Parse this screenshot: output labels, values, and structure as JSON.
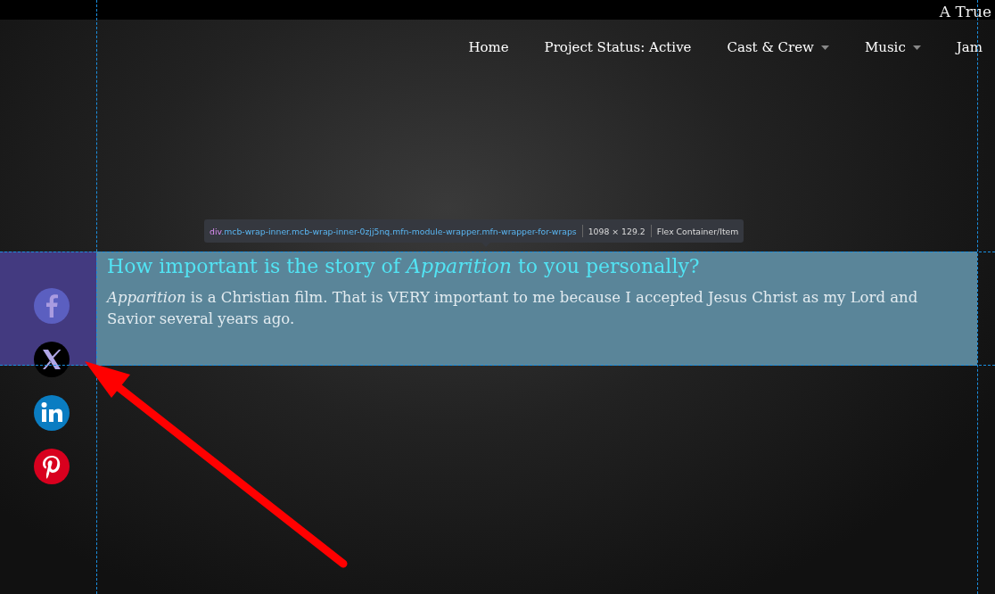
{
  "site_title": "A True",
  "nav": [
    {
      "label": "Home",
      "has_dropdown": false
    },
    {
      "label": "Project Status: Active",
      "has_dropdown": false
    },
    {
      "label": "Cast & Crew",
      "has_dropdown": true
    },
    {
      "label": "Music",
      "has_dropdown": true
    },
    {
      "label": "Jam",
      "has_dropdown": false
    }
  ],
  "inspector_tooltip": {
    "tag": "div",
    "classes": ".mcb-wrap-inner.mcb-wrap-inner-0zjj5nq.mfn-module-wrapper.mfn-wrapper-for-wraps",
    "size": "1098 × 129.2",
    "role": "Flex Container/Item"
  },
  "section": {
    "heading": "How important is the story of *Apparition* to you personally?",
    "body": "*Apparition* is a Christian film. That is VERY important to me because I accepted Jesus Christ as my Lord and Savior several years ago."
  },
  "social": [
    {
      "kind": "facebook"
    },
    {
      "kind": "x"
    },
    {
      "kind": "linkedin"
    },
    {
      "kind": "pinterest"
    }
  ]
}
